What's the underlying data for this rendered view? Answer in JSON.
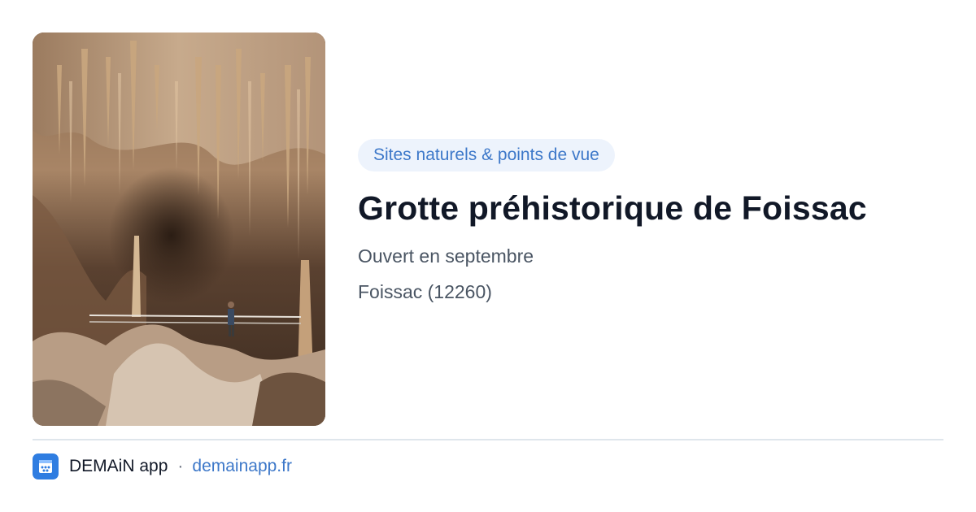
{
  "card": {
    "image_alt": "Cave interior with stalactites and a walkway",
    "category": "Sites naturels & points de vue",
    "title": "Grotte préhistorique de Foissac",
    "opening": "Ouvert en septembre",
    "location": "Foissac (12260)"
  },
  "footer": {
    "app_name": "DEMAiN app",
    "separator": "·",
    "domain": "demainapp.fr",
    "icon": "demain-app-logo-icon"
  },
  "colors": {
    "accent": "#3d78c9",
    "tag_bg": "#edf3fc",
    "title": "#111827",
    "muted": "#4a5563",
    "app_icon_bg": "#2f7de1"
  }
}
